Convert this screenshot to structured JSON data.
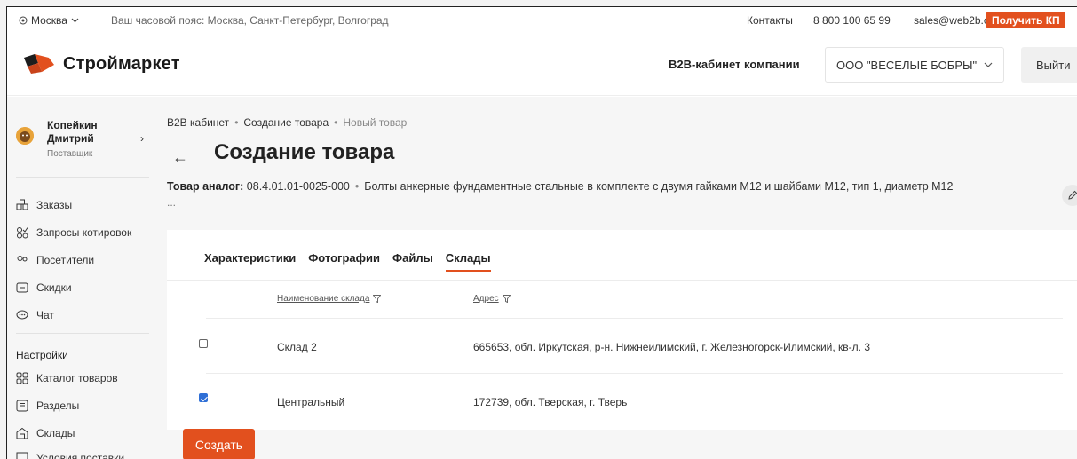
{
  "topbar": {
    "city": "Москва",
    "timezone": "Ваш часовой пояс: Москва, Санкт-Петербург, Волгоград",
    "contacts": "Контакты",
    "phone": "8 800 100 65 99",
    "email": "sales@web2b.co",
    "get_kp": "Получить КП"
  },
  "header": {
    "brand": "Строймаркет",
    "b2b_label": "B2B-кабинет компании",
    "company": "ООО \"ВЕСЕЛЫЕ БОБРЫ\"",
    "logout": "Выйти"
  },
  "user": {
    "first_line": "Копейкин",
    "second_line": "Дмитрий",
    "role": "Поставщик"
  },
  "sidebar": {
    "items": [
      {
        "label": "Заказы",
        "icon": "orders-icon"
      },
      {
        "label": "Запросы котировок",
        "icon": "quotes-icon"
      },
      {
        "label": "Посетители",
        "icon": "visitors-icon"
      },
      {
        "label": "Скидки",
        "icon": "discounts-icon"
      },
      {
        "label": "Чат",
        "icon": "chat-icon"
      }
    ],
    "settings_title": "Настройки",
    "settings_items": [
      {
        "label": "Каталог товаров",
        "icon": "catalog-icon"
      },
      {
        "label": "Разделы",
        "icon": "sections-icon"
      },
      {
        "label": "Склады",
        "icon": "warehouses-icon"
      },
      {
        "label": "Условия поставки",
        "icon": "delivery-terms-icon"
      }
    ]
  },
  "breadcrumbs": [
    "B2B кабинет",
    "Создание товара",
    "Новый товар"
  ],
  "page_title": "Создание товара",
  "analog": {
    "label": "Товар аналог:",
    "code": "08.4.01.01-0025-000",
    "name": "Болты анкерные фундаментные стальные в комплекте с двумя гайками М12 и шайбами М12, тип 1, диаметр М12",
    "more": "..."
  },
  "tabs": [
    "Характеристики",
    "Фотографии",
    "Файлы",
    "Склады"
  ],
  "active_tab": "Склады",
  "table": {
    "columns": [
      "Наименование склада",
      "Адрес"
    ],
    "rows": [
      {
        "checked": false,
        "name": "Склад 2",
        "address": "665653, обл. Иркутская, р-н. Нижнеилимский, г. Железногорск-Илимский, кв-л. 3"
      },
      {
        "checked": true,
        "name": "Центральный",
        "address": "172739, обл. Тверская, г. Тверь"
      }
    ]
  },
  "create_button": "Создать",
  "colors": {
    "accent": "#e2501e",
    "checkbox": "#2f6fd6"
  }
}
